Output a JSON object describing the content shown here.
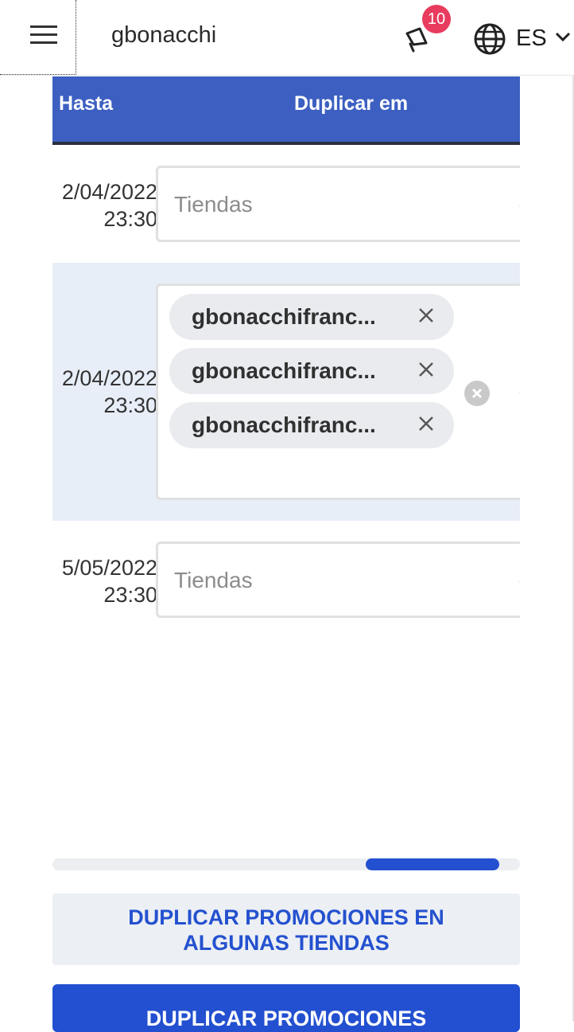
{
  "header": {
    "username": "gbonacchi",
    "notifications_count": "10",
    "language": "ES"
  },
  "table": {
    "columns": {
      "until": "Hasta",
      "duplicate_in": "Duplicar em"
    },
    "rows": [
      {
        "date": "2/04/2022",
        "time": "23:30",
        "placeholder": "Tiendas",
        "selected": []
      },
      {
        "date": "2/04/2022",
        "time": "23:30",
        "placeholder": "",
        "selected": [
          "gbonacchifranc...",
          "gbonacchifranc...",
          "gbonacchifranc..."
        ]
      },
      {
        "date": "5/05/2022",
        "time": "23:30",
        "placeholder": "Tiendas",
        "selected": []
      }
    ]
  },
  "scroll": {
    "position_fraction": 0.7
  },
  "actions": {
    "duplicate_some_line1": "DUPLICAR PROMOCIONES EN",
    "duplicate_some_line2": "ALGUNAS TIENDAS",
    "duplicate_all": "DUPLICAR PROMOCIONES"
  },
  "colors": {
    "accent": "#2350d0",
    "header_bg": "#3c5fc1",
    "badge": "#e83b5e",
    "row_highlight": "#e8eef8"
  }
}
